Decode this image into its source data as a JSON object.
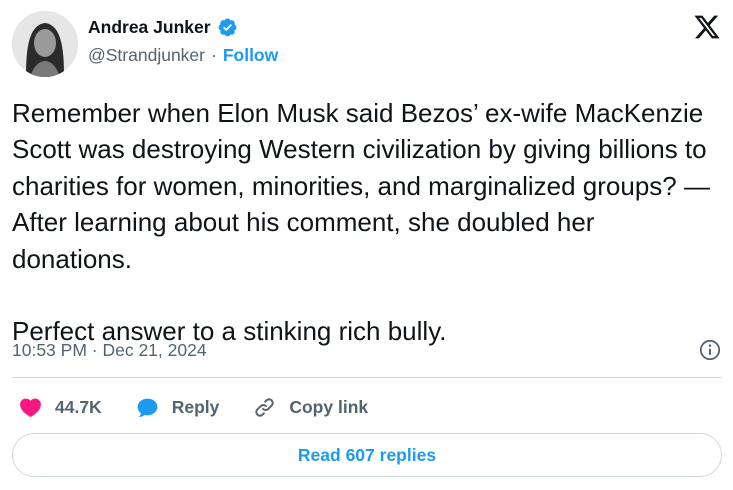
{
  "author": {
    "display_name": "Andrea Junker",
    "handle": "@Strandjunker",
    "separator": "·",
    "follow_label": "Follow"
  },
  "tweet": {
    "text": "Remember when Elon Musk said Bezos’ ex-wife MacKenzie Scott was destroying Western civilization by giving billions to charities for women, minorities, and marginalized groups? — After learning about his comment, she doubled her donations.\n\nPerfect answer to a stinking rich bully.",
    "timestamp": "10:53 PM · Dec 21, 2024"
  },
  "actions": {
    "likes_count": "44.7K",
    "reply_label": "Reply",
    "copy_link_label": "Copy link"
  },
  "footer": {
    "read_replies_label": "Read 607 replies"
  },
  "icons": {
    "verified": "verified-badge-icon",
    "brand": "x-logo-icon",
    "info": "info-icon",
    "like": "heart-icon",
    "reply": "speech-bubble-icon",
    "copy_link": "link-icon"
  },
  "colors": {
    "accent": "#1d9bf0",
    "like": "#f91880",
    "text": "#0f1419",
    "muted": "#536471",
    "border": "#cfd9de"
  }
}
